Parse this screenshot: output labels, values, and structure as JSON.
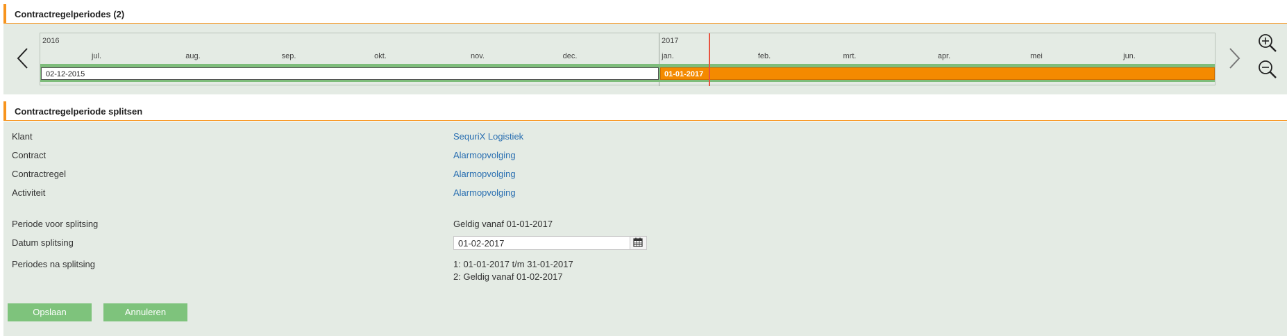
{
  "timeline_section": {
    "title": "Contractregelperiodes (2)",
    "years": [
      "2016",
      "2017"
    ],
    "months": [
      "jul.",
      "aug.",
      "sep.",
      "okt.",
      "nov.",
      "dec.",
      "jan.",
      "feb.",
      "mrt.",
      "apr.",
      "mei",
      "jun."
    ],
    "periods": [
      {
        "label": "02-12-2015",
        "color": "#ffffff"
      },
      {
        "label": "01-01-2017",
        "color": "#f48a00"
      }
    ],
    "today_marker_color": "#e8533f"
  },
  "split_section": {
    "title": "Contractregelperiode splitsen",
    "klant": {
      "label": "Klant",
      "value": "SequriX Logistiek"
    },
    "contract": {
      "label": "Contract",
      "value": "Alarmopvolging"
    },
    "contractregel": {
      "label": "Contractregel",
      "value": "Alarmopvolging"
    },
    "activiteit": {
      "label": "Activiteit",
      "value": "Alarmopvolging"
    },
    "periode_voor": {
      "label": "Periode voor splitsing",
      "value": "Geldig vanaf 01-01-2017"
    },
    "datum_splitsing": {
      "label": "Datum splitsing",
      "value": "01-02-2017"
    },
    "periodes_na": {
      "label": "Periodes na splitsing",
      "line1": "1: 01-01-2017 t/m 31-01-2017",
      "line2": "2: Geldig vanaf 01-02-2017"
    }
  },
  "buttons": {
    "save": "Opslaan",
    "cancel": "Annuleren"
  },
  "colors": {
    "accent": "#f7941d",
    "panel_bg": "#e4ebe4",
    "button_green": "#7ec37c",
    "link": "#2a6fb1"
  },
  "icons": [
    "chevron-left-icon",
    "chevron-right-icon",
    "zoom-in-icon",
    "zoom-out-icon",
    "calendar-icon"
  ]
}
